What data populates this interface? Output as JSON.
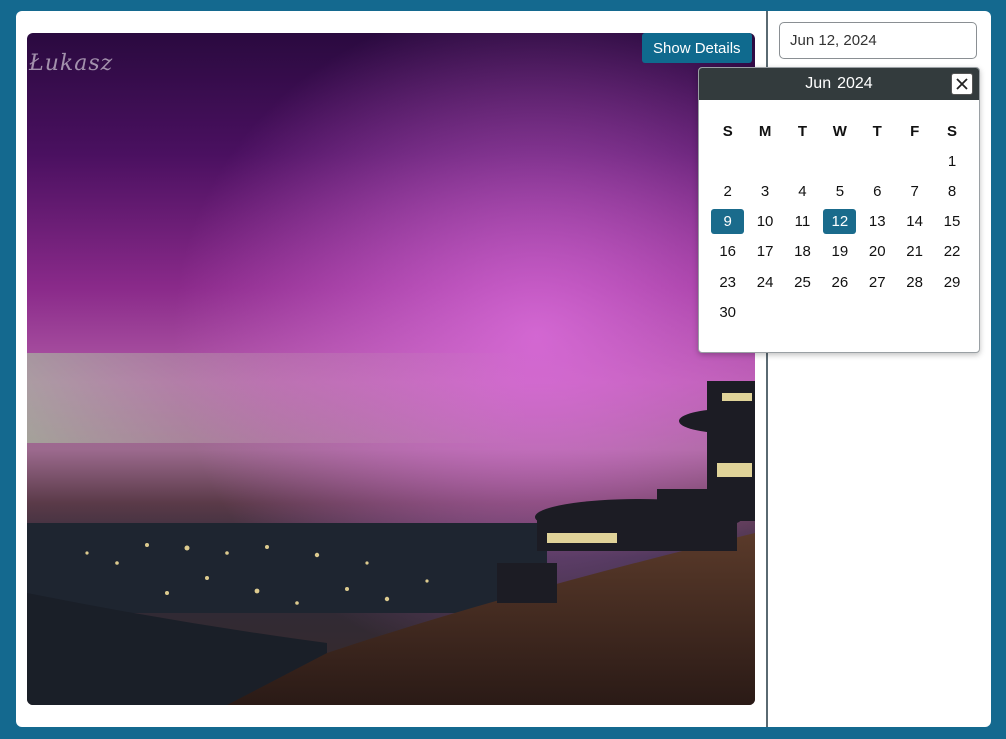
{
  "photo": {
    "signature": "Łukasz"
  },
  "show_details_label": "Show Details",
  "date_input": {
    "value": "Jun 12, 2024"
  },
  "datepicker": {
    "month": "Jun",
    "year": "2024",
    "close_icon": "close-icon",
    "weekdays": [
      "S",
      "M",
      "T",
      "W",
      "T",
      "F",
      "S"
    ],
    "weeks": [
      [
        "",
        "",
        "",
        "",
        "",
        "",
        "1"
      ],
      [
        "2",
        "3",
        "4",
        "5",
        "6",
        "7",
        "8"
      ],
      [
        "9",
        "10",
        "11",
        "12",
        "13",
        "14",
        "15"
      ],
      [
        "16",
        "17",
        "18",
        "19",
        "20",
        "21",
        "22"
      ],
      [
        "23",
        "24",
        "25",
        "26",
        "27",
        "28",
        "29"
      ],
      [
        "30",
        "",
        "",
        "",
        "",
        "",
        ""
      ]
    ],
    "highlighted_days": [
      "9",
      "12"
    ],
    "accent_color": "#1a6b8c"
  },
  "colors": {
    "background": "#14698f",
    "button": "#0f6a8e",
    "header": "#333b3d"
  }
}
